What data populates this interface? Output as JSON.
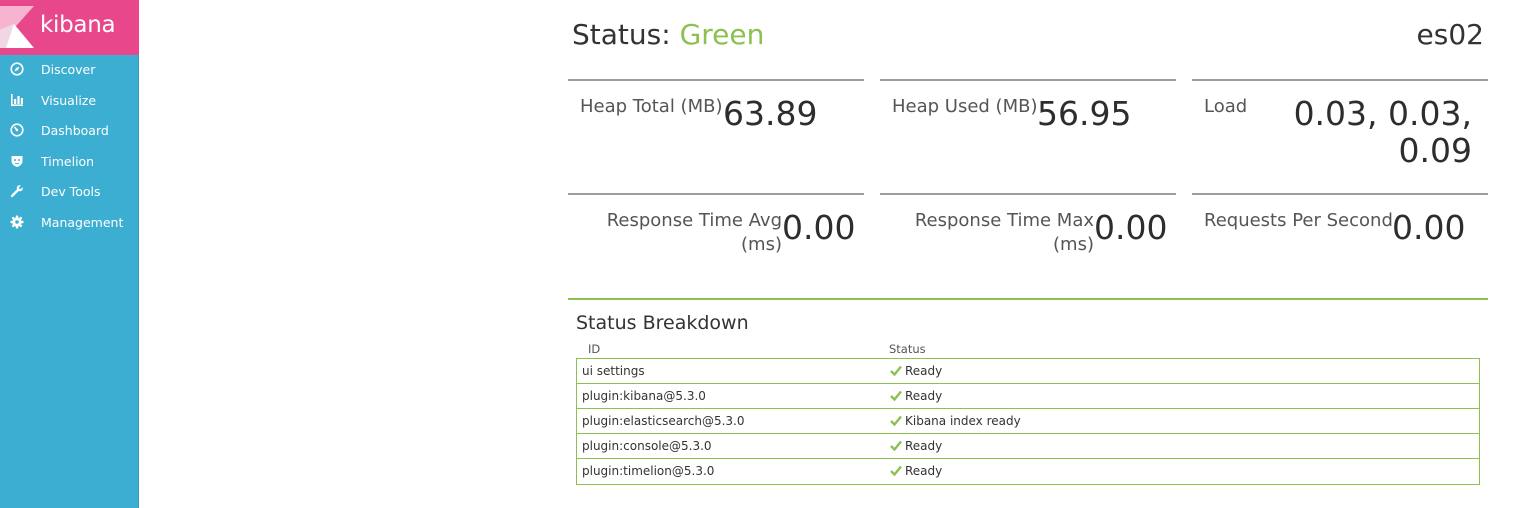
{
  "brand": {
    "name": "kibana",
    "color": "#e8488b"
  },
  "sidebar": {
    "background": "#3caed2",
    "items": [
      {
        "label": "Discover",
        "icon": "compass-icon"
      },
      {
        "label": "Visualize",
        "icon": "bar-chart-icon"
      },
      {
        "label": "Dashboard",
        "icon": "dashboard-gauge-icon"
      },
      {
        "label": "Timelion",
        "icon": "shield-face-icon"
      },
      {
        "label": "Dev Tools",
        "icon": "wrench-icon"
      },
      {
        "label": "Management",
        "icon": "gear-icon"
      }
    ]
  },
  "status": {
    "prefix": "Status: ",
    "value": "Green",
    "color": "#8cc152"
  },
  "server": {
    "name": "es02"
  },
  "metrics": {
    "heap_total": {
      "label": "Heap Total (MB)",
      "value": "63.89"
    },
    "heap_used": {
      "label": "Heap Used (MB)",
      "value": "56.95"
    },
    "load": {
      "label": "Load",
      "value_line1": "0.03, 0.03,",
      "value_line2": "0.09"
    },
    "resp_avg": {
      "label_line1": "Response Time Avg",
      "label_line2": "(ms)",
      "value": "0.00"
    },
    "resp_max": {
      "label_line1": "Response Time Max",
      "label_line2": "(ms)",
      "value": "0.00"
    },
    "rps": {
      "label": "Requests Per Second",
      "value": "0.00"
    }
  },
  "breakdown": {
    "title": "Status Breakdown",
    "columns": [
      "ID",
      "Status"
    ],
    "rows": [
      {
        "id": "ui settings",
        "status": "Ready"
      },
      {
        "id": "plugin:kibana@5.3.0",
        "status": "Ready"
      },
      {
        "id": "plugin:elasticsearch@5.3.0",
        "status": "Kibana index ready"
      },
      {
        "id": "plugin:console@5.3.0",
        "status": "Ready"
      },
      {
        "id": "plugin:timelion@5.3.0",
        "status": "Ready"
      }
    ]
  }
}
